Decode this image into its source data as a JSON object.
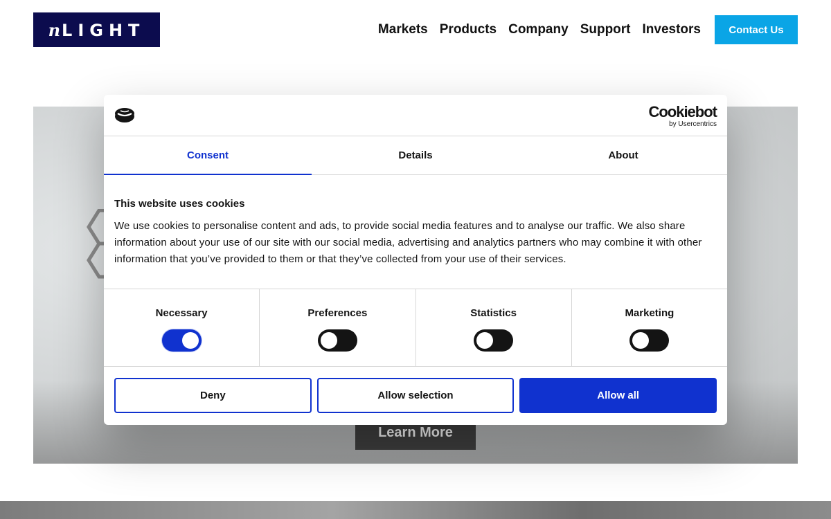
{
  "header": {
    "logo_text": "nLIGHT",
    "nav": [
      "Markets",
      "Products",
      "Company",
      "Support",
      "Investors"
    ],
    "contact_label": "Contact Us",
    "accent_color": "#0aa5e6"
  },
  "hero": {
    "learn_more_label": "Learn More"
  },
  "cookie_dialog": {
    "brand": {
      "name": "Cookiebot",
      "sub": "by Usercentrics"
    },
    "tabs": [
      "Consent",
      "Details",
      "About"
    ],
    "active_tab": "Consent",
    "title": "This website uses cookies",
    "text": "We use cookies to personalise content and ads, to provide social media features and to analyse our traffic. We also share information about your use of our site with our social media, advertising and analytics partners who may combine it with other information that you’ve provided to them or that they’ve collected from your use of their services.",
    "categories": [
      {
        "label": "Necessary",
        "enabled": true
      },
      {
        "label": "Preferences",
        "enabled": false
      },
      {
        "label": "Statistics",
        "enabled": false
      },
      {
        "label": "Marketing",
        "enabled": false
      }
    ],
    "buttons": {
      "deny": "Deny",
      "allow_selection": "Allow selection",
      "allow_all": "Allow all"
    },
    "accent_color": "#1032cf"
  }
}
